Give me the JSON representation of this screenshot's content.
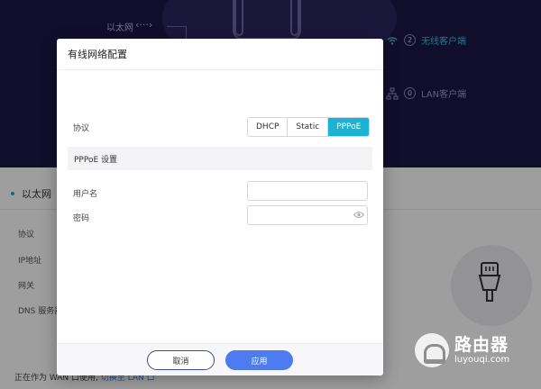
{
  "background": {
    "header": {
      "ethernet_label": "以太网",
      "ethernet_arrow": "‹···›",
      "wireless_clients": {
        "count": "2",
        "label": "无线客户端"
      },
      "lan_clients": {
        "count": "0",
        "label": "LAN客户端"
      }
    },
    "section": {
      "title": "以太网",
      "rows": [
        "协议",
        "IP地址",
        "网关",
        "DNS 服务器"
      ]
    },
    "footer": {
      "text": "正在作为 WAN 口使用,",
      "link": "切换至 LAN 口"
    }
  },
  "modal": {
    "title": "有线网络配置",
    "protocol_label": "协议",
    "protocol_options": [
      "DHCP",
      "Static",
      "PPPoE"
    ],
    "protocol_selected": "PPPoE",
    "pppoe_section_title": "PPPoE 设置",
    "username_label": "用户名",
    "username_value": "",
    "password_label": "密码",
    "password_value": "",
    "cancel_label": "取消",
    "apply_label": "应用"
  },
  "watermark": {
    "main": "路由器",
    "sub": "luyouqi.com"
  },
  "colors": {
    "header_bg": "#1c1748",
    "accent_teal": "#1bb2d3",
    "primary_blue": "#4f7bf0",
    "wireless_cyan": "#39c1d6"
  }
}
